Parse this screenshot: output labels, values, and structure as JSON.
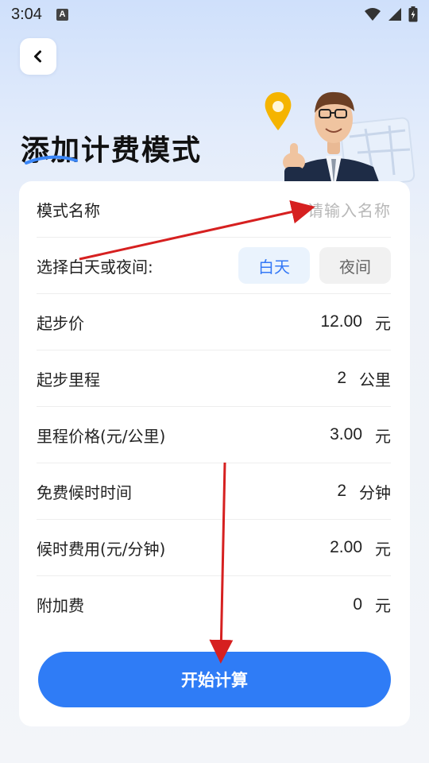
{
  "status_bar": {
    "time": "3:04",
    "a_icon": "A"
  },
  "header": {
    "title": "添加计费模式"
  },
  "form": {
    "name_label": "模式名称",
    "name_placeholder": "请输入名称",
    "period_label": "选择白天或夜间:",
    "day_option": "白天",
    "night_option": "夜间",
    "selected_period": "白天",
    "rows": [
      {
        "label": "起步价",
        "value": "12.00",
        "unit": "元"
      },
      {
        "label": "起步里程",
        "value": "2",
        "unit": "公里"
      },
      {
        "label": "里程价格(元/公里)",
        "value": "3.00",
        "unit": "元"
      },
      {
        "label": "免费候时时间",
        "value": "2",
        "unit": "分钟"
      },
      {
        "label": "候时费用(元/分钟)",
        "value": "2.00",
        "unit": "元"
      },
      {
        "label": "附加费",
        "value": "0",
        "unit": "元"
      }
    ]
  },
  "actions": {
    "start_label": "开始计算"
  },
  "colors": {
    "accent": "#2f7cf6",
    "annotation_arrow": "#d62020"
  },
  "icons": [
    "back-chevron-icon",
    "wifi-icon",
    "signal-icon",
    "battery-icon",
    "location-pin-icon"
  ]
}
